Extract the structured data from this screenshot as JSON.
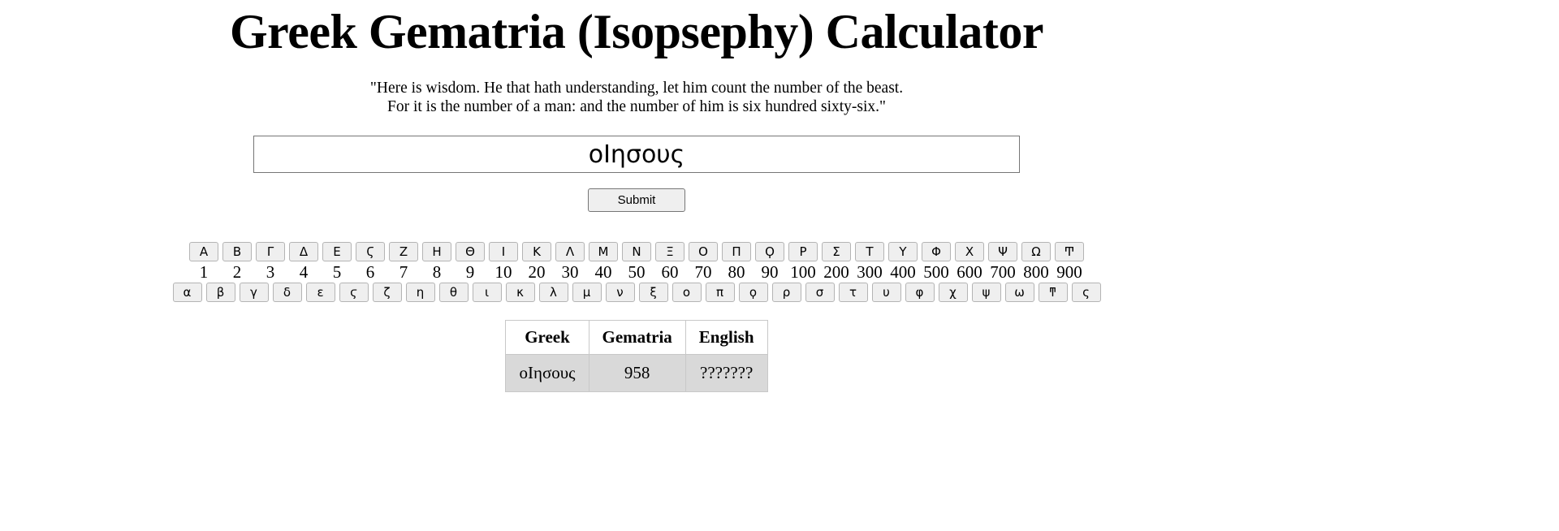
{
  "page": {
    "title": "Greek Gematria (Isopsephy) Calculator",
    "subtitle_line1": "\"Here is wisdom. He that hath understanding, let him count the number of the beast.",
    "subtitle_line2": "For it is the number of a man: and the number of him is six hundred sixty-six.\""
  },
  "form": {
    "input_value": "οΙησους",
    "input_placeholder": "",
    "submit_label": "Submit"
  },
  "keyboard": {
    "uppercase": [
      "Α",
      "Β",
      "Γ",
      "Δ",
      "Ε",
      "Ϛ",
      "Ζ",
      "Η",
      "Θ",
      "Ι",
      "Κ",
      "Λ",
      "Μ",
      "Ν",
      "Ξ",
      "Ο",
      "Π",
      "Ϙ",
      "Ρ",
      "Σ",
      "Τ",
      "Υ",
      "Φ",
      "Χ",
      "Ψ",
      "Ω",
      "Ͳ"
    ],
    "values": [
      "1",
      "2",
      "3",
      "4",
      "5",
      "6",
      "7",
      "8",
      "9",
      "10",
      "20",
      "30",
      "40",
      "50",
      "60",
      "70",
      "80",
      "90",
      "100",
      "200",
      "300",
      "400",
      "500",
      "600",
      "700",
      "800",
      "900"
    ],
    "lowercase": [
      "α",
      "β",
      "γ",
      "δ",
      "ε",
      "ϛ",
      "ζ",
      "η",
      "θ",
      "ι",
      "κ",
      "λ",
      "μ",
      "ν",
      "ξ",
      "ο",
      "π",
      "ϙ",
      "ρ",
      "σ",
      "τ",
      "υ",
      "φ",
      "χ",
      "ψ",
      "ω",
      "ͳ"
    ],
    "extra": [
      "ς"
    ]
  },
  "results": {
    "headers": [
      "Greek",
      "Gematria",
      "English"
    ],
    "rows": [
      {
        "greek": "οIησους",
        "gematria": "958",
        "english": "???????"
      }
    ]
  },
  "colors": {
    "button_face": "#efefef",
    "button_border": "#b4b4b4",
    "table_row_bg": "#d9d9d9",
    "table_border": "#c8c8c8",
    "input_border": "#767676"
  }
}
